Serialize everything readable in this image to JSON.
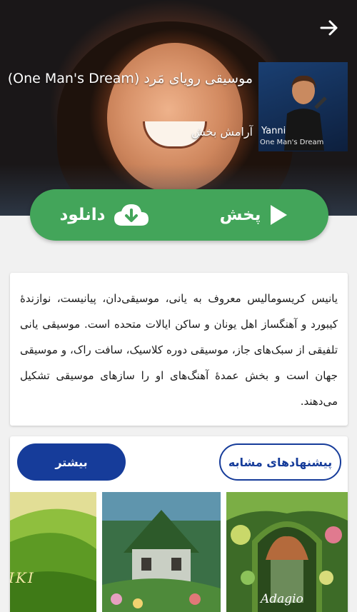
{
  "header": {
    "back_icon": "arrow-right-icon",
    "track_title": "موسیقی رویای مَرد (One Man's Dream)",
    "genre": "آرامش بخش",
    "album_artist": "Yanni",
    "album_name": "One Man's Dream"
  },
  "actions": {
    "play_label": "پخش",
    "play_icon": "play-icon",
    "download_label": "دانلود",
    "download_icon": "cloud-download-icon",
    "accent_color": "#43a55a"
  },
  "description": {
    "text": "یانیس کریسومالیس معروف به یانی، موسیقی‌دان، پیانیست، نوازندهٔ کیبورد و آهنگساز اهل یونان و ساکن ایالات متحده است. موسیقی یانی تلفیقی از سبک‌های جاز، موسیقی دوره کلاسیک، سافت راک، و موسیقی جهان است و بخش عمدهٔ آهنگ‌های او را سازهای موسیقی تشکیل می‌دهند."
  },
  "similar": {
    "title": "پیشنهادهای مشابه",
    "more_label": "بیشتر",
    "brand_color": "#163c9a",
    "thumbnails": [
      {
        "caption": "Adagio"
      },
      {
        "caption": ""
      },
      {
        "caption": "IKI"
      }
    ]
  }
}
